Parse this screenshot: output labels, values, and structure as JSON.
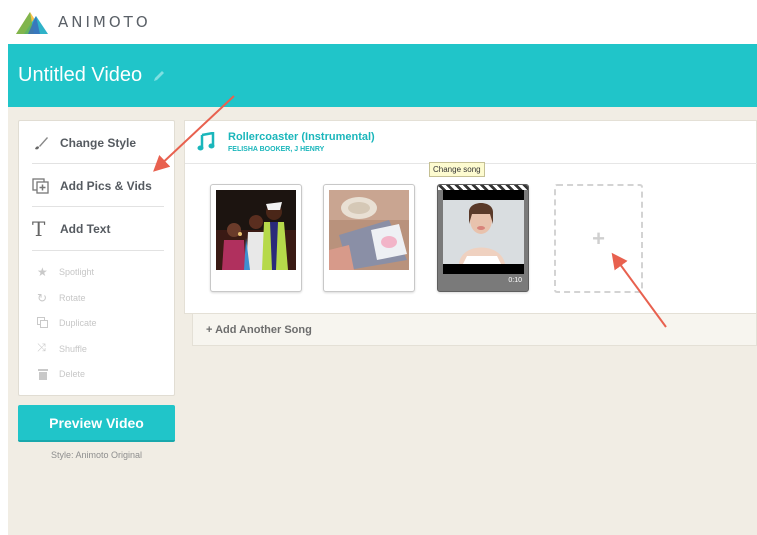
{
  "app": {
    "brand": "ANIMOTO"
  },
  "header": {
    "video_title": "Untitled Video"
  },
  "sidebar": {
    "main_items": [
      {
        "label": "Change Style",
        "icon": "brush-icon"
      },
      {
        "label": "Add Pics & Vids",
        "icon": "add-media-icon"
      },
      {
        "label": "Add Text",
        "icon": "text-icon"
      }
    ],
    "secondary_items": [
      {
        "label": "Spotlight",
        "icon": "star-icon"
      },
      {
        "label": "Rotate",
        "icon": "rotate-icon"
      },
      {
        "label": "Duplicate",
        "icon": "duplicate-icon"
      },
      {
        "label": "Shuffle",
        "icon": "shuffle-icon"
      },
      {
        "label": "Delete",
        "icon": "trash-icon"
      }
    ]
  },
  "preview": {
    "button_label": "Preview Video",
    "style_label": "Style: Animoto Original"
  },
  "song": {
    "title": "Rollercoaster (Instrumental)",
    "artist": "FELISHA BOOKER, J HENRY",
    "tooltip": "Change song"
  },
  "media": [
    {
      "type": "photo",
      "description": "prom-photo"
    },
    {
      "type": "photo",
      "description": "table-setting-photo"
    },
    {
      "type": "video",
      "duration": "0:10"
    }
  ],
  "add_slot": {
    "symbol": "+"
  },
  "add_song": {
    "label": "+ Add Another Song"
  },
  "colors": {
    "accent": "#20c5c9",
    "background": "#f1ede4",
    "annotation_arrow": "#e8614f"
  }
}
